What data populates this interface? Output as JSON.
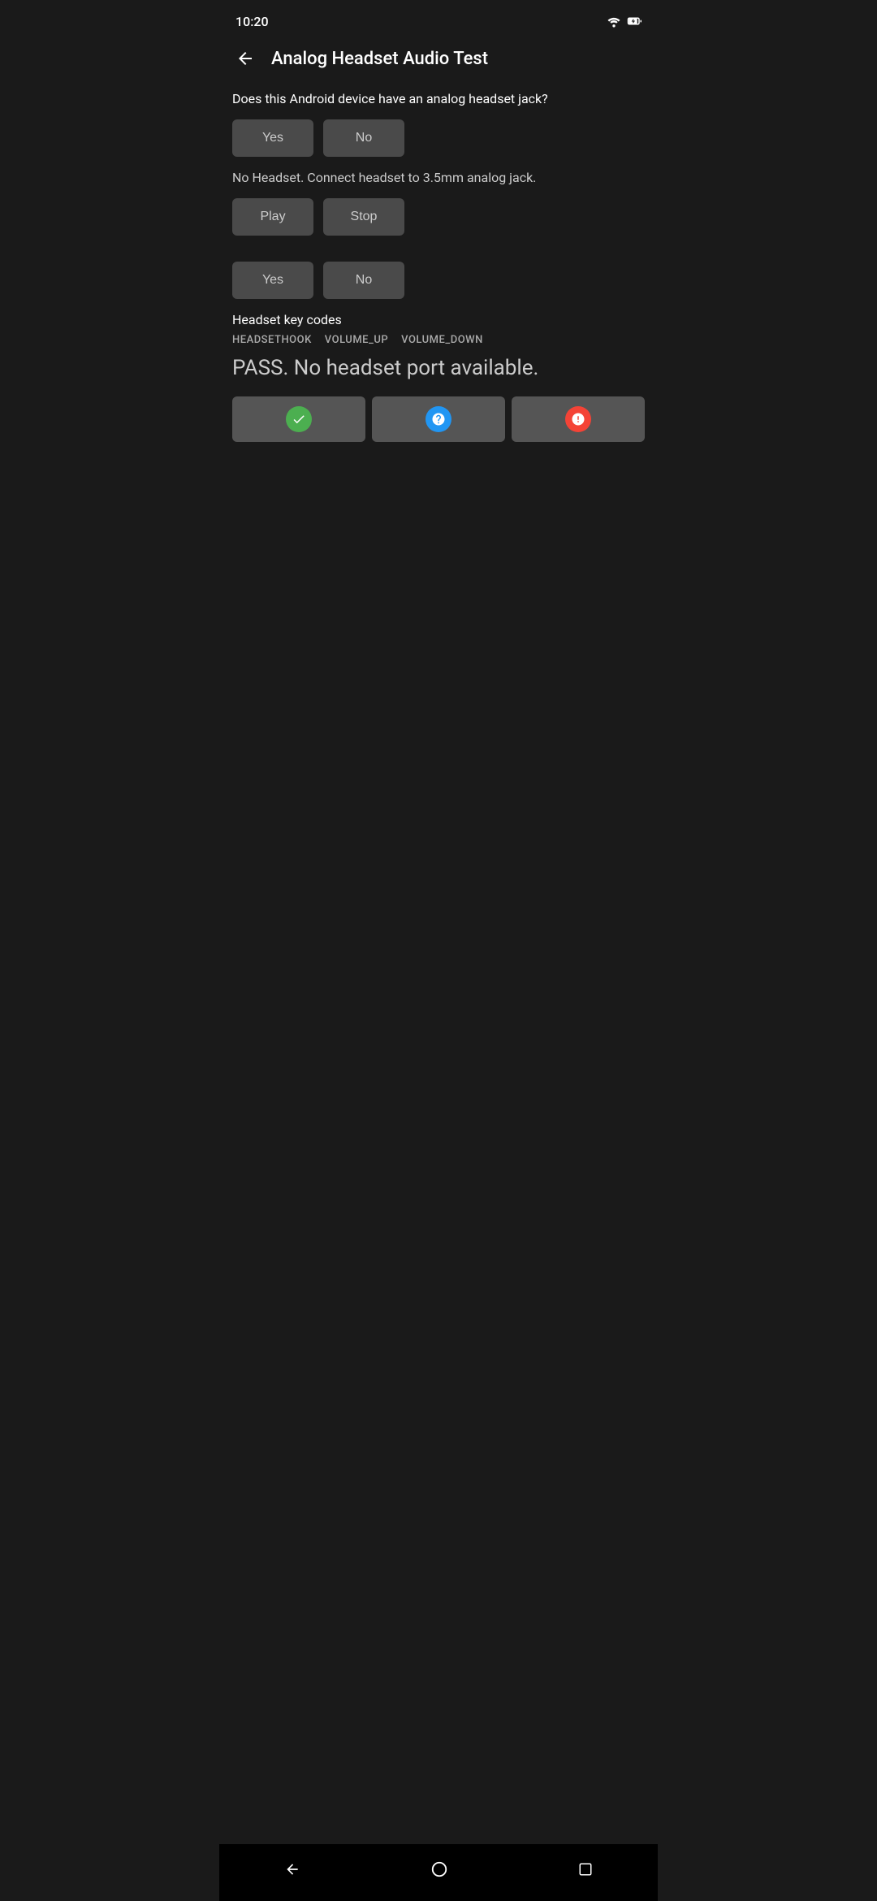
{
  "statusBar": {
    "time": "10:20"
  },
  "header": {
    "backLabel": "←",
    "title": "Analog Headset Audio Test"
  },
  "section1": {
    "question": "Does this Android device have an analog headset jack?",
    "yesLabel": "Yes",
    "noLabel": "No"
  },
  "section2": {
    "instruction": "No Headset. Connect headset to 3.5mm analog jack.",
    "playLabel": "Play",
    "stopLabel": "Stop",
    "yesLabel": "Yes",
    "noLabel": "No"
  },
  "keyCodes": {
    "label": "Headset key codes",
    "items": [
      "HEADSETHOOK",
      "VOLUME_UP",
      "VOLUME_DOWN"
    ]
  },
  "result": {
    "text": "PASS. No headset port available."
  },
  "actionButtons": {
    "passIcon": "✓",
    "infoIcon": "?",
    "failIcon": "!"
  }
}
